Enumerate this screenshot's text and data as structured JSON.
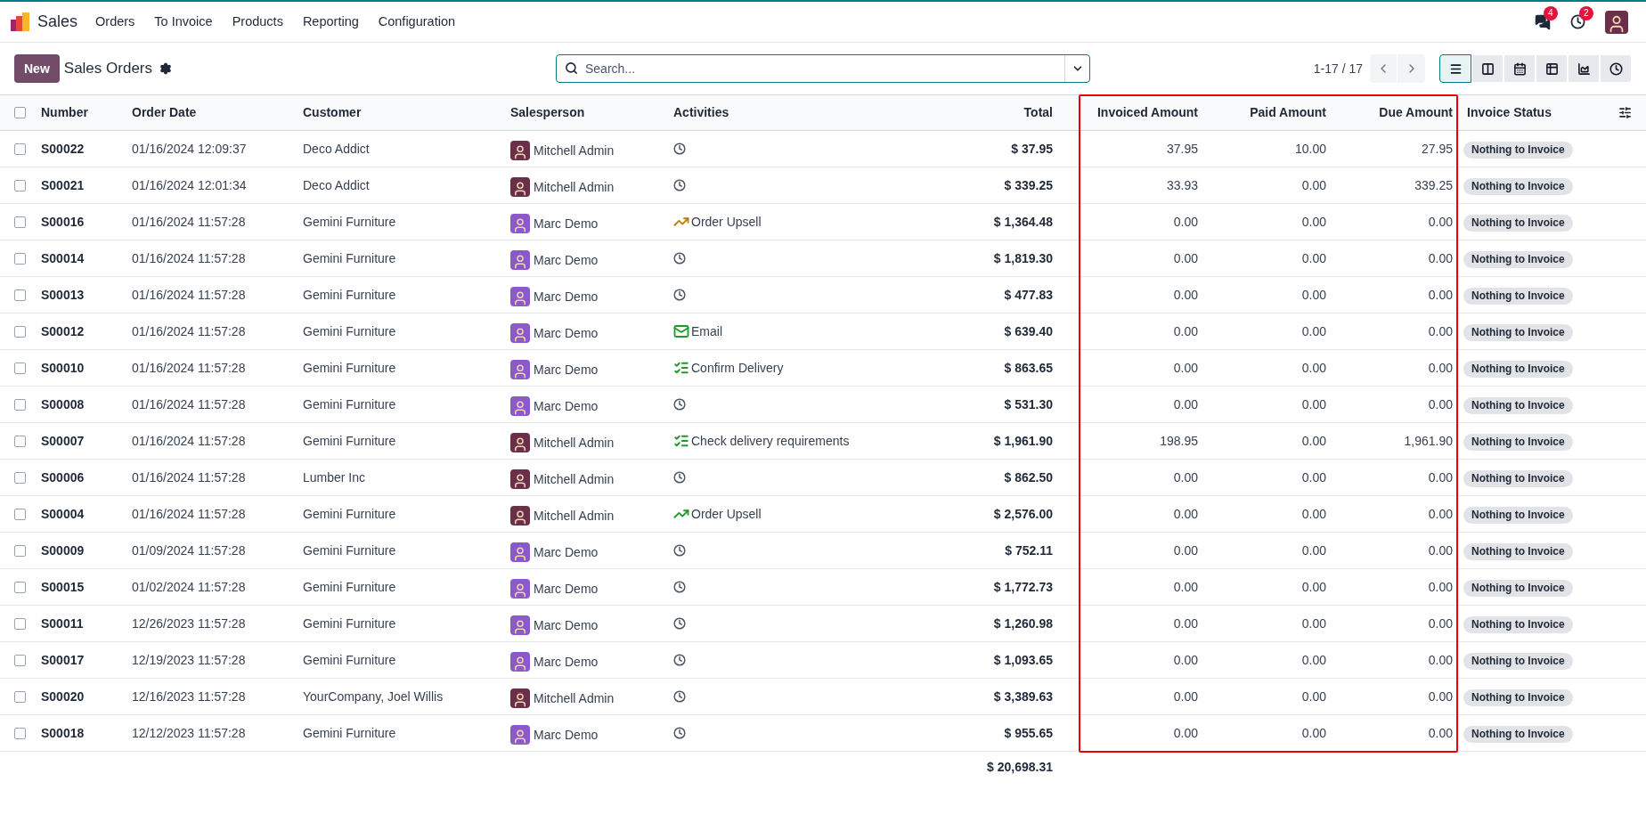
{
  "navbar": {
    "app": "Sales",
    "menu": [
      "Orders",
      "To Invoice",
      "Products",
      "Reporting",
      "Configuration"
    ],
    "messages_badge": "4",
    "activities_badge": "2"
  },
  "control_panel": {
    "new_button": "New",
    "title": "Sales Orders",
    "search": {
      "placeholder": "Search..."
    },
    "pager": "1-17 / 17",
    "views": [
      {
        "kind": "list",
        "selected": true
      },
      {
        "kind": "kanban",
        "selected": false
      },
      {
        "kind": "calendar",
        "selected": false
      },
      {
        "kind": "pivot",
        "selected": false
      },
      {
        "kind": "graph",
        "selected": false
      },
      {
        "kind": "activity",
        "selected": false
      }
    ]
  },
  "table": {
    "select_all_checked": false,
    "columns": [
      "Number",
      "Order Date",
      "Customer",
      "Salesperson",
      "Activities",
      "Total",
      "Invoiced Amount",
      "Paid Amount",
      "Due Amount",
      "Invoice Status"
    ],
    "rows": [
      {
        "checked": false,
        "number": "S00022",
        "date": "01/16/2024 12:09:37",
        "customer": "Deco Addict",
        "salesperson": {
          "name": "Mitchell Admin",
          "kind": "cartoon"
        },
        "activity": {
          "kind": "clock"
        },
        "total": "$ 37.95",
        "invoiced": "37.95",
        "paid": "10.00",
        "due": "27.95",
        "status": "Nothing to Invoice"
      },
      {
        "checked": false,
        "number": "S00021",
        "date": "01/16/2024 12:01:34",
        "customer": "Deco Addict",
        "salesperson": {
          "name": "Mitchell Admin",
          "kind": "cartoon"
        },
        "activity": {
          "kind": "clock"
        },
        "total": "$ 339.25",
        "invoiced": "33.93",
        "paid": "0.00",
        "due": "339.25",
        "status": "Nothing to Invoice"
      },
      {
        "checked": false,
        "number": "S00016",
        "date": "01/16/2024 11:57:28",
        "customer": "Gemini Furniture",
        "salesperson": {
          "name": "Marc Demo",
          "kind": "photo"
        },
        "activity": {
          "kind": "upsell",
          "label": "Order Upsell",
          "color": "#b7800b"
        },
        "total": "$ 1,364.48",
        "invoiced": "0.00",
        "paid": "0.00",
        "due": "0.00",
        "status": "Nothing to Invoice"
      },
      {
        "checked": false,
        "number": "S00014",
        "date": "01/16/2024 11:57:28",
        "customer": "Gemini Furniture",
        "salesperson": {
          "name": "Marc Demo",
          "kind": "photo"
        },
        "activity": {
          "kind": "clock"
        },
        "total": "$ 1,819.30",
        "invoiced": "0.00",
        "paid": "0.00",
        "due": "0.00",
        "status": "Nothing to Invoice"
      },
      {
        "checked": false,
        "number": "S00013",
        "date": "01/16/2024 11:57:28",
        "customer": "Gemini Furniture",
        "salesperson": {
          "name": "Marc Demo",
          "kind": "photo"
        },
        "activity": {
          "kind": "clock"
        },
        "total": "$ 477.83",
        "invoiced": "0.00",
        "paid": "0.00",
        "due": "0.00",
        "status": "Nothing to Invoice"
      },
      {
        "checked": false,
        "number": "S00012",
        "date": "01/16/2024 11:57:28",
        "customer": "Gemini Furniture",
        "salesperson": {
          "name": "Marc Demo",
          "kind": "photo"
        },
        "activity": {
          "kind": "email",
          "label": "Email",
          "color": "#1f9b2e"
        },
        "total": "$ 639.40",
        "invoiced": "0.00",
        "paid": "0.00",
        "due": "0.00",
        "status": "Nothing to Invoice"
      },
      {
        "checked": false,
        "number": "S00010",
        "date": "01/16/2024 11:57:28",
        "customer": "Gemini Furniture",
        "salesperson": {
          "name": "Marc Demo",
          "kind": "photo"
        },
        "activity": {
          "kind": "tasks",
          "label": "Confirm Delivery",
          "color": "#1f9b2e"
        },
        "total": "$ 863.65",
        "invoiced": "0.00",
        "paid": "0.00",
        "due": "0.00",
        "status": "Nothing to Invoice"
      },
      {
        "checked": false,
        "number": "S00008",
        "date": "01/16/2024 11:57:28",
        "customer": "Gemini Furniture",
        "salesperson": {
          "name": "Marc Demo",
          "kind": "photo"
        },
        "activity": {
          "kind": "clock"
        },
        "total": "$ 531.30",
        "invoiced": "0.00",
        "paid": "0.00",
        "due": "0.00",
        "status": "Nothing to Invoice"
      },
      {
        "checked": false,
        "number": "S00007",
        "date": "01/16/2024 11:57:28",
        "customer": "Gemini Furniture",
        "salesperson": {
          "name": "Mitchell Admin",
          "kind": "cartoon"
        },
        "activity": {
          "kind": "tasks",
          "label": "Check delivery requirements",
          "color": "#1f9b2e"
        },
        "total": "$ 1,961.90",
        "invoiced": "198.95",
        "paid": "0.00",
        "due": "1,961.90",
        "status": "Nothing to Invoice"
      },
      {
        "checked": false,
        "number": "S00006",
        "date": "01/16/2024 11:57:28",
        "customer": "Lumber Inc",
        "salesperson": {
          "name": "Mitchell Admin",
          "kind": "cartoon"
        },
        "activity": {
          "kind": "clock"
        },
        "total": "$ 862.50",
        "invoiced": "0.00",
        "paid": "0.00",
        "due": "0.00",
        "status": "Nothing to Invoice"
      },
      {
        "checked": false,
        "number": "S00004",
        "date": "01/16/2024 11:57:28",
        "customer": "Gemini Furniture",
        "salesperson": {
          "name": "Mitchell Admin",
          "kind": "cartoon"
        },
        "activity": {
          "kind": "upsell",
          "label": "Order Upsell",
          "color": "#1f9b2e"
        },
        "total": "$ 2,576.00",
        "invoiced": "0.00",
        "paid": "0.00",
        "due": "0.00",
        "status": "Nothing to Invoice"
      },
      {
        "checked": false,
        "number": "S00009",
        "date": "01/09/2024 11:57:28",
        "customer": "Gemini Furniture",
        "salesperson": {
          "name": "Marc Demo",
          "kind": "photo"
        },
        "activity": {
          "kind": "clock"
        },
        "total": "$ 752.11",
        "invoiced": "0.00",
        "paid": "0.00",
        "due": "0.00",
        "status": "Nothing to Invoice"
      },
      {
        "checked": false,
        "number": "S00015",
        "date": "01/02/2024 11:57:28",
        "customer": "Gemini Furniture",
        "salesperson": {
          "name": "Marc Demo",
          "kind": "photo"
        },
        "activity": {
          "kind": "clock"
        },
        "total": "$ 1,772.73",
        "invoiced": "0.00",
        "paid": "0.00",
        "due": "0.00",
        "status": "Nothing to Invoice"
      },
      {
        "checked": false,
        "number": "S00011",
        "date": "12/26/2023 11:57:28",
        "customer": "Gemini Furniture",
        "salesperson": {
          "name": "Marc Demo",
          "kind": "photo"
        },
        "activity": {
          "kind": "clock"
        },
        "total": "$ 1,260.98",
        "invoiced": "0.00",
        "paid": "0.00",
        "due": "0.00",
        "status": "Nothing to Invoice"
      },
      {
        "checked": false,
        "number": "S00017",
        "date": "12/19/2023 11:57:28",
        "customer": "Gemini Furniture",
        "salesperson": {
          "name": "Marc Demo",
          "kind": "photo"
        },
        "activity": {
          "kind": "clock"
        },
        "total": "$ 1,093.65",
        "invoiced": "0.00",
        "paid": "0.00",
        "due": "0.00",
        "status": "Nothing to Invoice"
      },
      {
        "checked": false,
        "number": "S00020",
        "date": "12/16/2023 11:57:28",
        "customer": "YourCompany, Joel Willis",
        "salesperson": {
          "name": "Mitchell Admin",
          "kind": "cartoon"
        },
        "activity": {
          "kind": "clock"
        },
        "total": "$ 3,389.63",
        "invoiced": "0.00",
        "paid": "0.00",
        "due": "0.00",
        "status": "Nothing to Invoice"
      },
      {
        "checked": false,
        "number": "S00018",
        "date": "12/12/2023 11:57:28",
        "customer": "Gemini Furniture",
        "salesperson": {
          "name": "Marc Demo",
          "kind": "photo"
        },
        "activity": {
          "kind": "clock"
        },
        "total": "$ 955.65",
        "invoiced": "0.00",
        "paid": "0.00",
        "due": "0.00",
        "status": "Nothing to Invoice"
      }
    ],
    "footer_total": "$ 20,698.31"
  }
}
